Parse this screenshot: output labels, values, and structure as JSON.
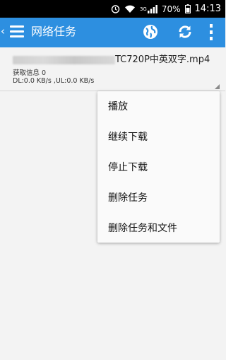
{
  "status_bar": {
    "battery": "70%",
    "time": "14:13",
    "network": "3G"
  },
  "app_bar": {
    "title": "网络任务"
  },
  "task": {
    "name_suffix": "TC720P中英双字.mp4",
    "info": "获取信息  0",
    "speed": "DL:0.0 KB/s ,UL:0.0 KB/s"
  },
  "menu": {
    "items": [
      "播放",
      "继续下载",
      "停止下载",
      "删除任务",
      "删除任务和文件"
    ]
  },
  "colors": {
    "app_bar": "#2d8fe0",
    "status_bar": "#000000",
    "background": "#f3f3f3"
  }
}
